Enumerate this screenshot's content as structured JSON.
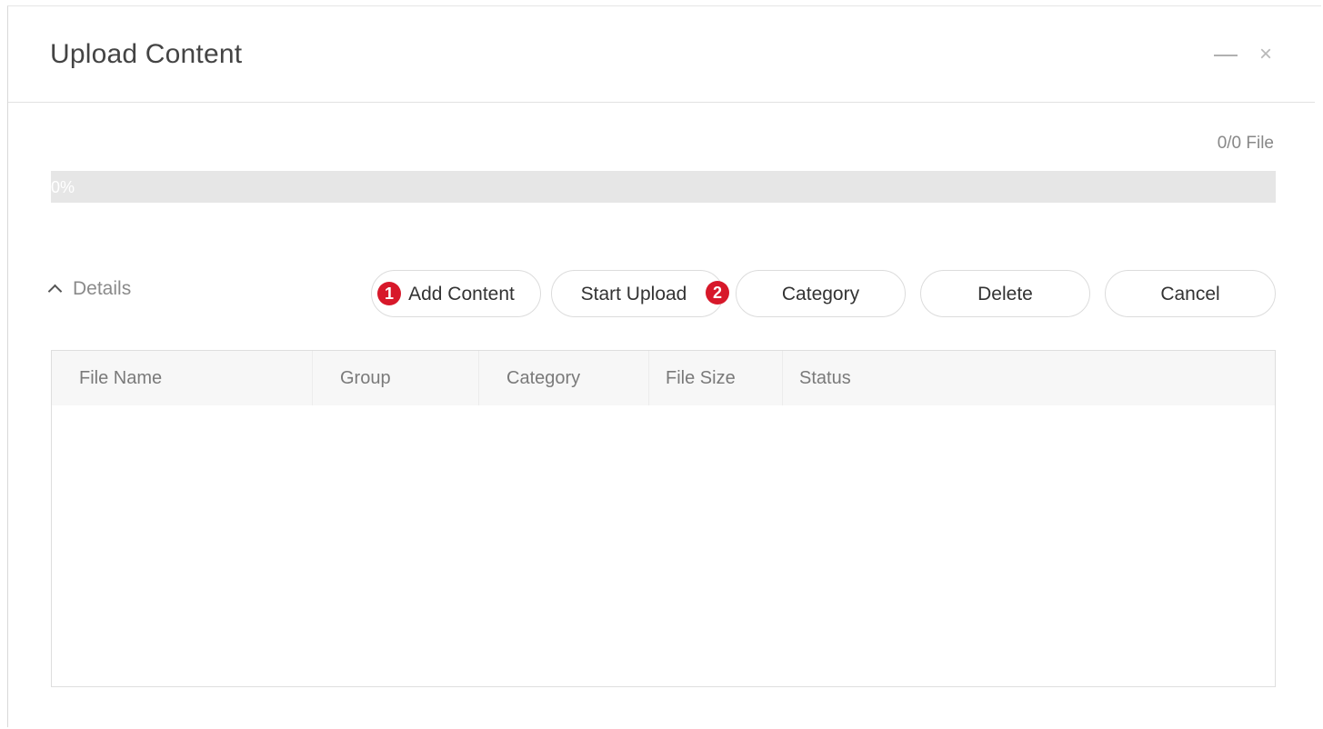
{
  "dialog": {
    "title": "Upload Content",
    "minimize_label": "—",
    "close_label": "×"
  },
  "upload": {
    "file_count": "0/0 File",
    "progress_percent": 0,
    "progress_text": "0%"
  },
  "details": {
    "toggle_label": "Details"
  },
  "toolbar": {
    "add_content_label": "Add Content",
    "start_upload_label": "Start Upload",
    "category_label": "Category",
    "delete_label": "Delete",
    "cancel_label": "Cancel"
  },
  "markers": {
    "marker_1": "1",
    "marker_2": "2",
    "color": "#d7182a"
  },
  "table": {
    "columns": [
      "File Name",
      "Group",
      "Category",
      "File Size",
      "Status"
    ],
    "rows": []
  },
  "icons": {
    "details_toggle": "chevron-up-icon",
    "minimize": "minimize-icon",
    "close": "close-icon"
  }
}
